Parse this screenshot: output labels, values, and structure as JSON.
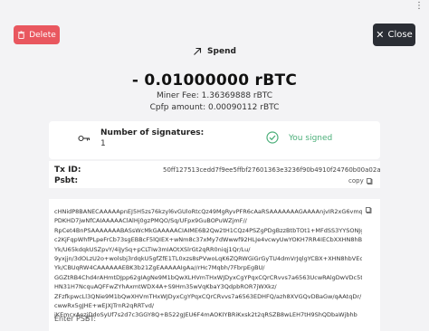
{
  "window": {
    "menu_icon": "more-vertical-icon"
  },
  "toolbar": {
    "delete_label": "Delete",
    "close_label": "Close"
  },
  "header": {
    "spend_label": "Spend",
    "amount": "- 0.01000000 rBTC",
    "miner_fee": "Miner Fee: 1.36369888 rBTC",
    "cpfp_amount": "Cpfp amount: 0.00090112 rBTC"
  },
  "signatures": {
    "title": "Number of signatures:",
    "count": "1",
    "status": "You signed"
  },
  "info": {
    "txid_label": "Tx ID:",
    "txid_value": "50ff127513cedd7f9ee5ffbf27601363e3236f90b4910f24760b00a02a0aeb9f",
    "psbt_label": "Psbt:",
    "copy_label": "copy"
  },
  "psbt": {
    "lines": [
      "cHNidP8BANECAAAAApnEJ5H5zs76kzyl6vGUloRtcQz49MgRyvPFR6cAaRSAAAAAAAGAAAAnjvIR2xG6vmqo5S",
      "PDKHD7jwNfCAIAAAAAClAlHj0gzPMQO/Sq/UFpx9GuBOPuWZjmF//",
      "RpCet4BnPSAAAAAAABASsWcMkGAAAAACIAIME6B2Qw2tH1CQz4PSZgPDgBzzBtbTOt1+MFdSS3YYSONJgtCBCx",
      "c2KjFqpWhfPLpeFrCb73sgEBBcF5lQIEX+wNm8c37xMy7dWwwf92HLJe4vcwyUwYOKH7RR4IECbXXHN8hBVL",
      "Yk/U65kdqkUSZpvY/4iJySq+pCLTIw3mIAOtXSlrGt2qRR0niqj1Qr/Lu/",
      "9yxjjn/3dOLzU2o+wolsbj3rdqkU5gfZfE1TL0xzs8sPVwoLqK6ZQRWGiGrGyTU4dmVrJqlgYCBX+XHN8hbVEcNL92c5+",
      "Yk/CBUqRW4CAAAAAAEBK3b21ZgEAAAAAIgAa//rHc7Mqbh/7FbrpEgBU/",
      "GGZtRB4Chd4rAHmtDJpp62gIAgNe9M1bQwXLHVmTHxWJDyxCgYPqxCQrCRvvs7a6563UcwRAlgDwVDc5tGQ",
      "HN31H7NcquAQFFwZYhAxmtWDX4A+S9Hm35wVqKbaY3QdpbROR7jWXkz/",
      "ZFzfkpwcLl3QNie9M1bQwXHVmTHxWJDyxCgYPqxCQrCRvvs7a6563EDHFQ/azh8XVGQvDBaGw/qAAtqDr/",
      "cwwRx5gJHE+wEJXJTrnR2qRRTvd/",
      "jKEmcxAezjDdoSyUf7s2d7c3GGY8Q+B522gJEU6F4mAOKIYBRiKxsk2t2qRSZB8wLEH7tH9ShQDbaWjbhb"
    ],
    "input_label": "Enter PSBT:"
  }
}
